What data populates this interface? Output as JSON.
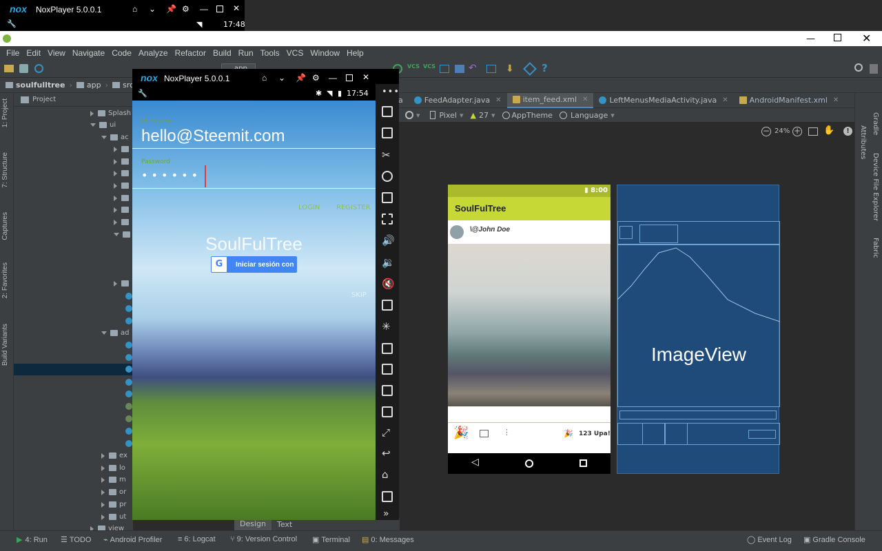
{
  "nox_small": {
    "title": "NoxPlayer 5.0.0.1",
    "time": "17:48"
  },
  "nox_main": {
    "title": "NoxPlayer 5.0.0.1",
    "time": "17:54",
    "username_label": "Username",
    "username_value": "hello@Steemit.com",
    "password_label": "Password",
    "password_dots": "• • • • • •",
    "login": "LOGIN",
    "register": "REGISTER",
    "app_name": "SoulFulTree",
    "google_button": "Iniciar sesión con",
    "skip": "SKIP"
  },
  "menubar": [
    "File",
    "Edit",
    "View",
    "Navigate",
    "Code",
    "Analyze",
    "Refactor",
    "Build",
    "Run",
    "Tools",
    "VCS",
    "Window",
    "Help"
  ],
  "toolbar": {
    "run_config": "app"
  },
  "breadcrumb": [
    "soulfulltree",
    "app",
    "src"
  ],
  "left_tabs": [
    "1: Project",
    "7: Structure",
    "Captures",
    "2: Favorites",
    "Build Variants"
  ],
  "project_header": "Project",
  "tree": {
    "splash": "Splash",
    "ui": "ui",
    "ac": "ac",
    "ad": "ad",
    "ex": "ex",
    "lo": "lo",
    "m": "m",
    "or": "or",
    "pr": "pr",
    "ut": "ut",
    "view": "view"
  },
  "editor_tabs": [
    "a",
    "FeedAdapter.java",
    "item_feed.xml",
    "LeftMenusMediaActivity.java",
    "AndroidManifest.xml"
  ],
  "design_toolbar": {
    "device": "Pixel",
    "api": "27",
    "theme": "AppTheme",
    "language": "Language"
  },
  "zoom": "24%",
  "right_tabs": [
    "Gradle",
    "Attributes",
    "Device File Explorer",
    "Fabric"
  ],
  "preview": {
    "time": "8:00",
    "app_title": "SoulFulTree",
    "user": "\\@John Doe",
    "upvotes": "123 Upa!"
  },
  "blueprint": {
    "label": "ImageView"
  },
  "design_text_tabs": [
    "Design",
    "Text"
  ],
  "status_buttons": [
    "4: Run",
    "TODO",
    "Android Profiler",
    "6: Logcat",
    "9: Version Control",
    "Terminal",
    "0: Messages",
    "Event Log",
    "Gradle Console"
  ],
  "colors": {
    "studio_bg": "#2b2b2b",
    "panel": "#3c3f41",
    "toolbar_lime": "#c6d836",
    "blueprint": "#1e4b7a",
    "nox_accent": "#24a8e0"
  }
}
